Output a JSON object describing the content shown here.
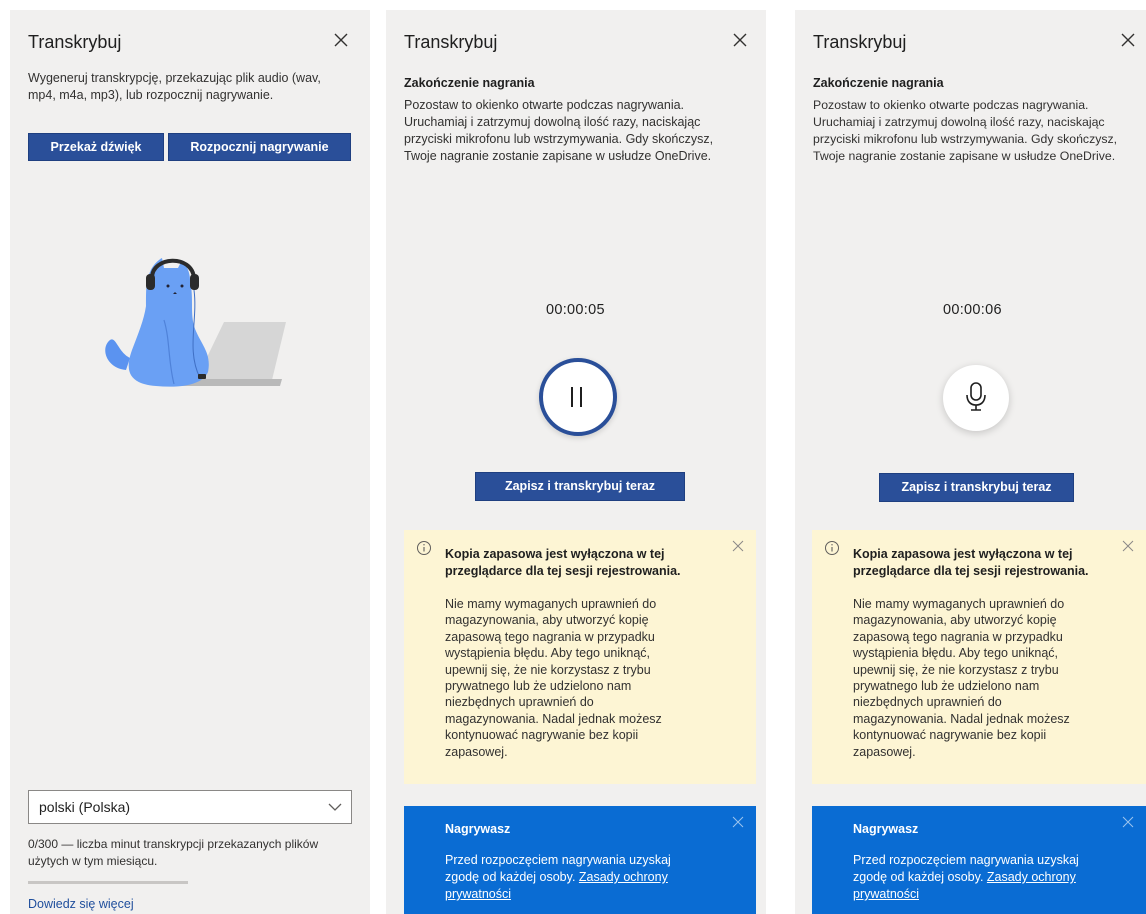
{
  "panel1": {
    "title": "Transkrybuj",
    "description_line1": "Wygeneruj transkrypcję, przekazując plik audio (wav,",
    "description_line2": "mp4, m4a, mp3), lub rozpocznij nagrywanie.",
    "upload_button": "Przekaż dźwięk",
    "record_button": "Rozpocznij nagrywanie",
    "language_value": "polski (Polska)",
    "quota_line1": "0/300 — liczba minut transkrypcji przekazanych plików",
    "quota_line2": "użytych w tym miesiącu.",
    "quota_used": 0,
    "quota_total": 300,
    "learn_more": "Dowiedz się więcej"
  },
  "recording": {
    "title": "Transkrybuj",
    "subhead": "Zakończenie nagrania",
    "desc_line1": "Pozostaw to okienko otwarte podczas nagrywania.",
    "desc_line2": "Uruchamiaj i zatrzymuj dowolną ilość razy, naciskając",
    "desc_line3": "przyciski mikrofonu lub wstrzymywania. Gdy skończysz,",
    "desc_line4": "Twoje nagranie zostanie zapisane w usłudze OneDrive.",
    "save_button": "Zapisz i transkrybuj teraz",
    "warning_title_line1": "Kopia zapasowa jest wyłączona w tej",
    "warning_title_line2": "przeglądarce dla tej sesji rejestrowania.",
    "warning_body": [
      "Nie mamy wymaganych uprawnień do",
      "magazynowania, aby utworzyć kopię",
      "zapasową tego nagrania w przypadku",
      "wystąpienia błędu. Aby tego uniknąć,",
      "upewnij się, że nie korzystasz z trybu",
      "prywatnego lub że udzielono nam",
      "niezbędnych uprawnień do",
      "magazynowania. Nadal jednak możesz",
      "kontynuować nagrywanie bez kopii",
      "zapasowej."
    ],
    "notice_title": "Nagrywasz",
    "notice_line1": "Przed rozpoczęciem nagrywania uzyskaj",
    "notice_line2_prefix": "zgodę od każdej osoby. ",
    "notice_link_part1": "Zasady ochrony",
    "notice_link_part2": "prywatności"
  },
  "panel2": {
    "timer": "00:00:05",
    "state": "recording"
  },
  "panel3": {
    "timer": "00:00:06",
    "state": "paused"
  },
  "colors": {
    "panel_bg": "#f1f0ef",
    "primary": "#2a4f99",
    "warning_bg": "#fdf5d4",
    "notice_bg": "#0a6cd3",
    "link": "#1f4e9c"
  },
  "icons": [
    "close-icon",
    "chevron-down-icon",
    "pause-icon",
    "microphone-icon",
    "info-icon",
    "cat-headphones-illustration"
  ]
}
